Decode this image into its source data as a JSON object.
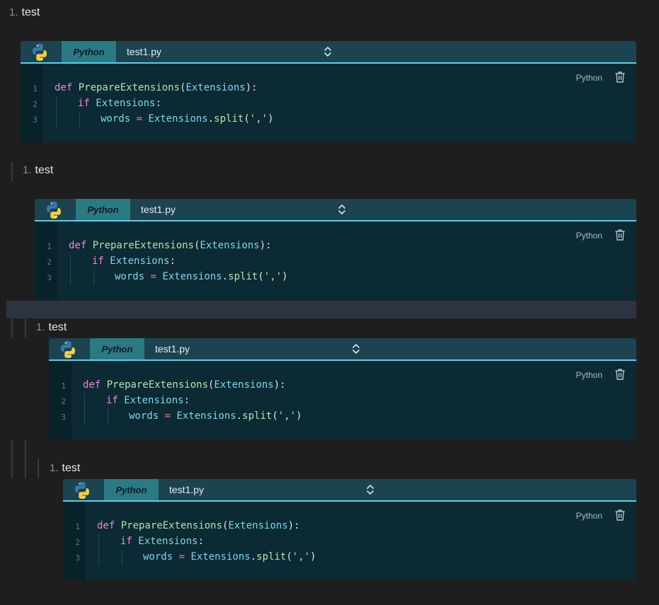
{
  "items": [
    {
      "num": "1.",
      "text": "test"
    },
    {
      "num": "1.",
      "text": "test"
    },
    {
      "num": "1.",
      "text": "test"
    },
    {
      "num": "1.",
      "text": "test"
    }
  ],
  "blocks": [
    {
      "language_tab": "Python",
      "file_name": "test1.py",
      "language_badge": "Python",
      "lines": [
        {
          "num": "1",
          "tokens": [
            {
              "t": "kw",
              "v": "def "
            },
            {
              "t": "fn",
              "v": "PrepareExtensions"
            },
            {
              "t": "tx",
              "v": "("
            },
            {
              "t": "pm",
              "v": "Extensions"
            },
            {
              "t": "tx",
              "v": "):"
            }
          ]
        },
        {
          "num": "2",
          "tokens": [
            {
              "t": "kw",
              "v": "if "
            },
            {
              "t": "pm",
              "v": "Extensions"
            },
            {
              "t": "tx",
              "v": ":"
            }
          ]
        },
        {
          "num": "3",
          "tokens": [
            {
              "t": "pm",
              "v": "words "
            },
            {
              "t": "op",
              "v": "= "
            },
            {
              "t": "pm",
              "v": "Extensions"
            },
            {
              "t": "tx",
              "v": "."
            },
            {
              "t": "fn",
              "v": "split"
            },
            {
              "t": "tx",
              "v": "("
            },
            {
              "t": "st",
              "v": "','"
            },
            {
              "t": "tx",
              "v": ")"
            }
          ]
        }
      ]
    },
    {
      "language_tab": "Python",
      "file_name": "test1.py",
      "language_badge": "Python",
      "lines": [
        {
          "num": "1",
          "tokens": [
            {
              "t": "kw",
              "v": "def "
            },
            {
              "t": "fn",
              "v": "PrepareExtensions"
            },
            {
              "t": "tx",
              "v": "("
            },
            {
              "t": "pm",
              "v": "Extensions"
            },
            {
              "t": "tx",
              "v": "):"
            }
          ]
        },
        {
          "num": "2",
          "tokens": [
            {
              "t": "kw",
              "v": "if "
            },
            {
              "t": "pm",
              "v": "Extensions"
            },
            {
              "t": "tx",
              "v": ":"
            }
          ]
        },
        {
          "num": "3",
          "tokens": [
            {
              "t": "pm",
              "v": "words "
            },
            {
              "t": "op",
              "v": "= "
            },
            {
              "t": "pm",
              "v": "Extensions"
            },
            {
              "t": "tx",
              "v": "."
            },
            {
              "t": "fn",
              "v": "split"
            },
            {
              "t": "tx",
              "v": "("
            },
            {
              "t": "st",
              "v": "','"
            },
            {
              "t": "tx",
              "v": ")"
            }
          ]
        }
      ]
    },
    {
      "language_tab": "Python",
      "file_name": "test1.py",
      "language_badge": "Python",
      "lines": [
        {
          "num": "1",
          "tokens": [
            {
              "t": "kw",
              "v": "def "
            },
            {
              "t": "fn",
              "v": "PrepareExtensions"
            },
            {
              "t": "tx",
              "v": "("
            },
            {
              "t": "pm",
              "v": "Extensions"
            },
            {
              "t": "tx",
              "v": "):"
            }
          ]
        },
        {
          "num": "2",
          "tokens": [
            {
              "t": "kw",
              "v": "if "
            },
            {
              "t": "pm",
              "v": "Extensions"
            },
            {
              "t": "tx",
              "v": ":"
            }
          ]
        },
        {
          "num": "3",
          "tokens": [
            {
              "t": "pm",
              "v": "words "
            },
            {
              "t": "op",
              "v": "= "
            },
            {
              "t": "pm",
              "v": "Extensions"
            },
            {
              "t": "tx",
              "v": "."
            },
            {
              "t": "fn",
              "v": "split"
            },
            {
              "t": "tx",
              "v": "("
            },
            {
              "t": "st",
              "v": "','"
            },
            {
              "t": "tx",
              "v": ")"
            }
          ]
        }
      ]
    },
    {
      "language_tab": "Python",
      "file_name": "test1.py",
      "language_badge": "Python",
      "lines": [
        {
          "num": "1",
          "tokens": [
            {
              "t": "kw",
              "v": "def "
            },
            {
              "t": "fn",
              "v": "PrepareExtensions"
            },
            {
              "t": "tx",
              "v": "("
            },
            {
              "t": "pm",
              "v": "Extensions"
            },
            {
              "t": "tx",
              "v": "):"
            }
          ]
        },
        {
          "num": "2",
          "tokens": [
            {
              "t": "kw",
              "v": "if "
            },
            {
              "t": "pm",
              "v": "Extensions"
            },
            {
              "t": "tx",
              "v": ":"
            }
          ]
        },
        {
          "num": "3",
          "tokens": [
            {
              "t": "pm",
              "v": "words "
            },
            {
              "t": "op",
              "v": "= "
            },
            {
              "t": "pm",
              "v": "Extensions"
            },
            {
              "t": "tx",
              "v": "."
            },
            {
              "t": "fn",
              "v": "split"
            },
            {
              "t": "tx",
              "v": "("
            },
            {
              "t": "st",
              "v": "','"
            },
            {
              "t": "tx",
              "v": ")"
            }
          ]
        }
      ]
    }
  ],
  "colors": {
    "page_bg": "#1e1e1e",
    "header_bg": "#1b4350",
    "tab_bg": "#2a7a84",
    "accent_line": "#5ad0e6",
    "code_bg": "#0b2a33",
    "highlight_band": "#2c3341"
  }
}
